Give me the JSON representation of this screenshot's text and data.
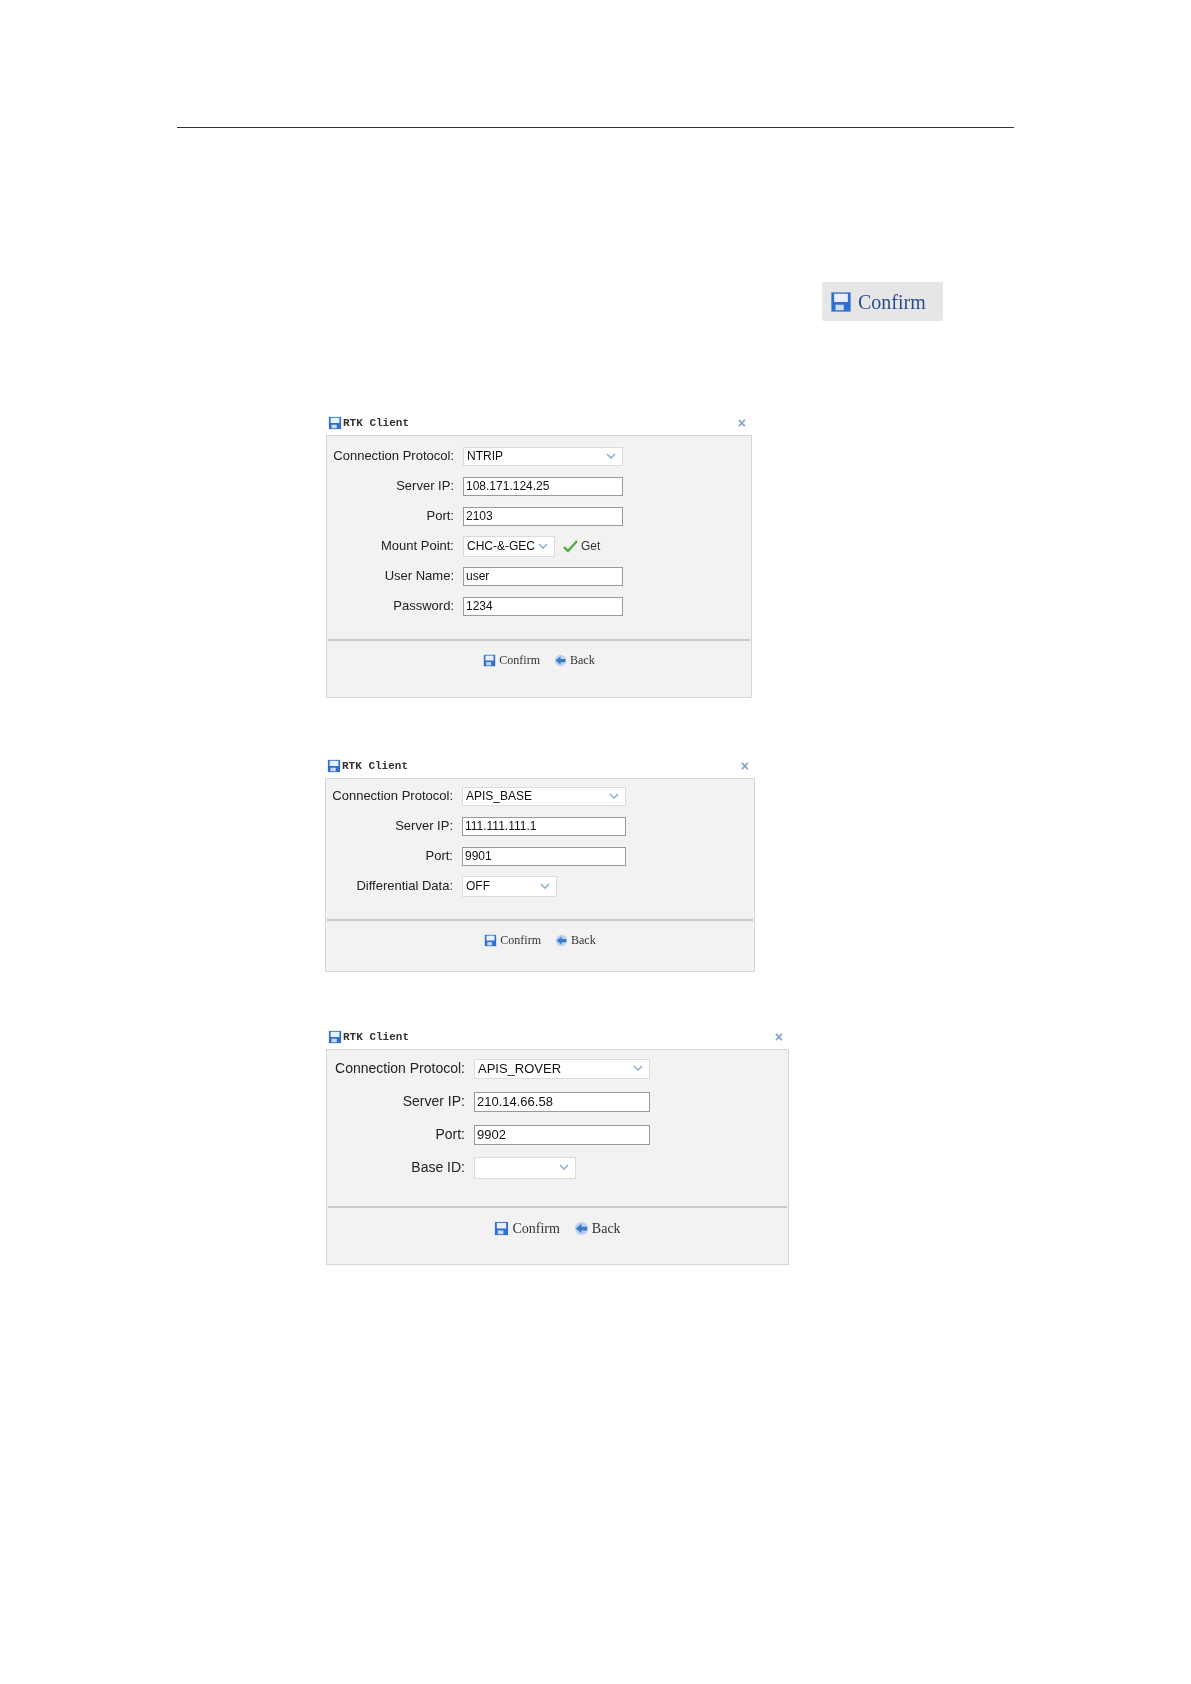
{
  "confirm_button": "Confirm",
  "dialogs": [
    {
      "title": "RTK Client",
      "close": "×",
      "fields": [
        {
          "label": "Connection Protocol:",
          "kind": "select",
          "value": "NTRIP"
        },
        {
          "label": "Server IP:",
          "kind": "text",
          "value": "108.171.124.25"
        },
        {
          "label": "Port:",
          "kind": "text",
          "value": "2103"
        },
        {
          "label": "Mount Point:",
          "kind": "dropdown",
          "value": "CHC-&-GEC",
          "get_button": "Get"
        },
        {
          "label": "User Name:",
          "kind": "text",
          "value": "user"
        },
        {
          "label": "Password:",
          "kind": "text",
          "value": "1234"
        }
      ],
      "buttons": [
        "Confirm",
        "Back"
      ]
    },
    {
      "title": "RTK Client",
      "close": "×",
      "fields": [
        {
          "label": "Connection Protocol:",
          "kind": "select",
          "value": "APIS_BASE"
        },
        {
          "label": "Server IP:",
          "kind": "text",
          "value": "111.111.111.1"
        },
        {
          "label": "Port:",
          "kind": "text",
          "value": "9901"
        },
        {
          "label": "Differential Data:",
          "kind": "dropdown",
          "value": "OFF"
        }
      ],
      "buttons": [
        "Confirm",
        "Back"
      ]
    },
    {
      "title": "RTK Client",
      "close": "×",
      "fields": [
        {
          "label": "Connection Protocol:",
          "kind": "select",
          "value": "APIS_ROVER"
        },
        {
          "label": "Server IP:",
          "kind": "text",
          "value": "210.14.66.58"
        },
        {
          "label": "Port:",
          "kind": "text",
          "value": "9902"
        },
        {
          "label": "Base ID:",
          "kind": "dropdown"
        }
      ],
      "buttons": [
        "Confirm",
        "Back"
      ]
    }
  ]
}
